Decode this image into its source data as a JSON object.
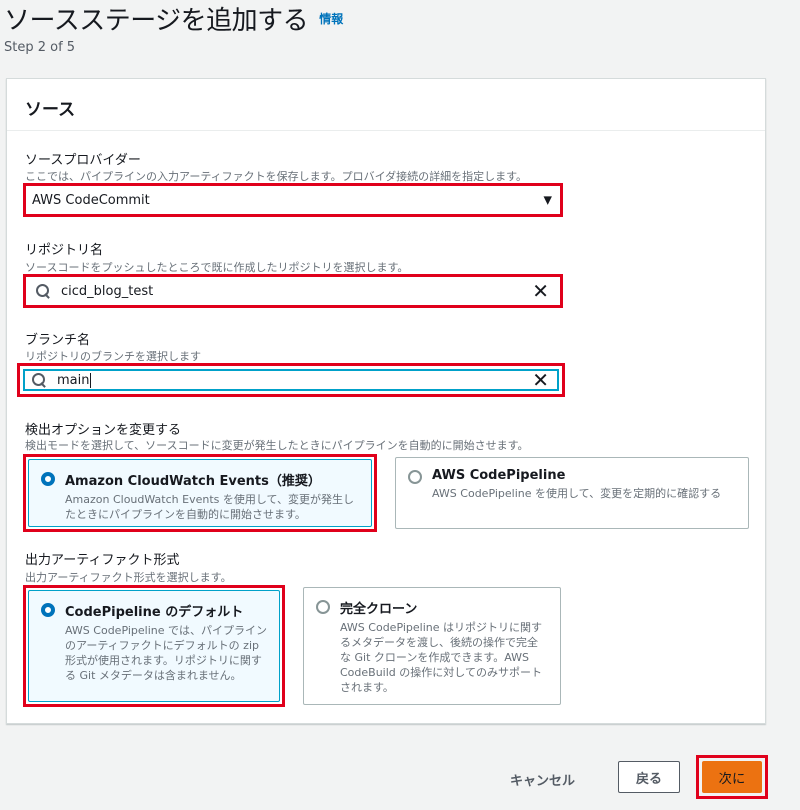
{
  "header": {
    "title": "ソースステージを追加する",
    "info_link": "情報",
    "step": "Step 2 of 5"
  },
  "panel": {
    "title": "ソース",
    "provider": {
      "label": "ソースプロバイダー",
      "description": "ここでは、パイプラインの入力アーティファクトを保存します。プロバイダ接続の詳細を指定します。",
      "value": "AWS CodeCommit"
    },
    "repository": {
      "label": "リポジトリ名",
      "description": "ソースコードをプッシュしたところで既に作成したリポジトリを選択します。",
      "value": "cicd_blog_test"
    },
    "branch": {
      "label": "ブランチ名",
      "description": "リポジトリのブランチを選択します",
      "value": "main"
    },
    "detection": {
      "label": "検出オプションを変更する",
      "description": "検出モードを選択して、ソースコードに変更が発生したときにパイプラインを自動的に開始させます。",
      "options": [
        {
          "title": "Amazon CloudWatch Events（推奨）",
          "description": "Amazon CloudWatch Events を使用して、変更が発生したときにパイプラインを自動的に開始させます。",
          "selected": true
        },
        {
          "title": "AWS CodePipeline",
          "description": "AWS CodePipeline を使用して、変更を定期的に確認する",
          "selected": false
        }
      ]
    },
    "artifact": {
      "label": "出力アーティファクト形式",
      "description": "出力アーティファクト形式を選択します。",
      "options": [
        {
          "title": "CodePipeline のデフォルト",
          "description": "AWS CodePipeline では、パイプラインのアーティファクトにデフォルトの zip 形式が使用されます。リポジトリに関する Git メタデータは含まれません。",
          "selected": true
        },
        {
          "title": "完全クローン",
          "description": "AWS CodePipeline はリポジトリに関するメタデータを渡し、後続の操作で完全な Git クローンを作成できます。AWS CodeBuild の操作に対してのみサポートされます。",
          "selected": false
        }
      ]
    }
  },
  "footer": {
    "cancel": "キャンセル",
    "back": "戻る",
    "next": "次に"
  },
  "colors": {
    "accent": "#0073bb",
    "primary_button": "#ec7211",
    "highlight": "#e0001b"
  }
}
